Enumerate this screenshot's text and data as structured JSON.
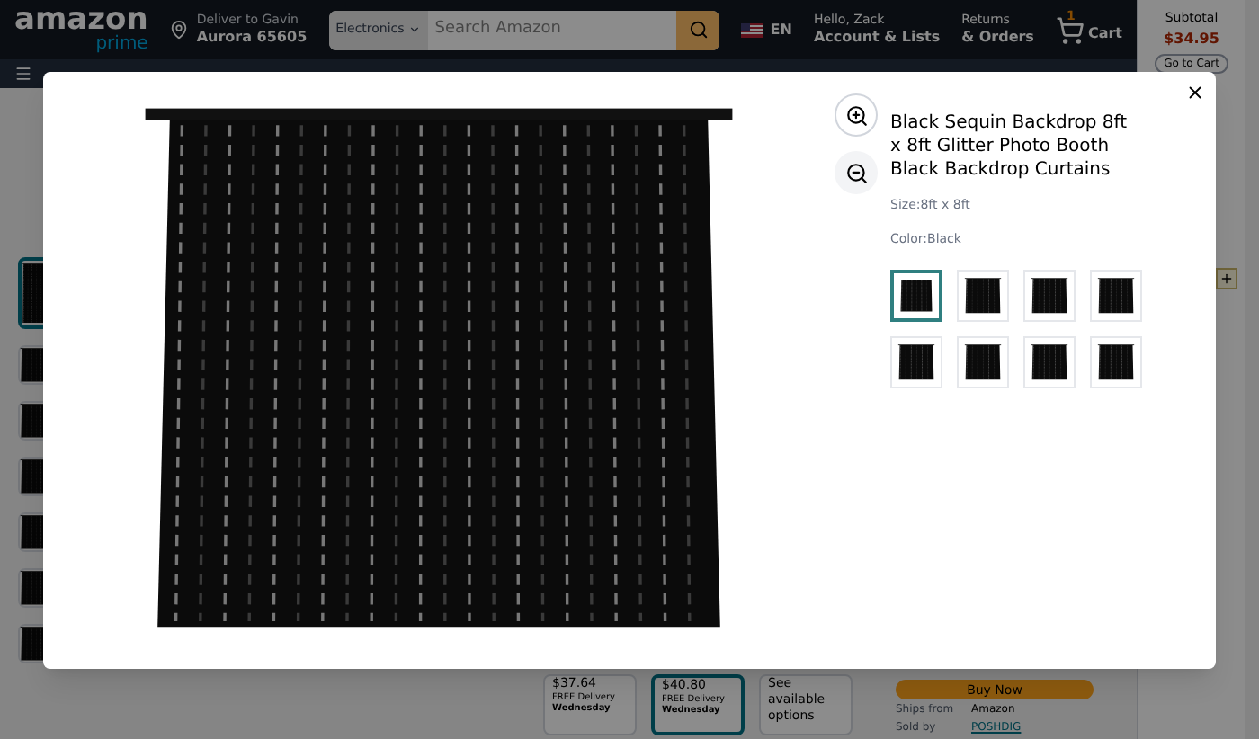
{
  "header": {
    "logo": "amazon",
    "logo_sub": "prime",
    "deliver_line1": "Deliver to Gavin",
    "deliver_line2": "Aurora 65605",
    "search_category": "Electronics",
    "search_placeholder": "Search Amazon",
    "language": "EN",
    "account_line1": "Hello, Zack",
    "account_line2": "Account & Lists",
    "orders_line1": "Returns",
    "orders_line2": "& Orders",
    "cart_count": "1",
    "cart_label": "Cart"
  },
  "subtotal": {
    "label": "Subtotal",
    "amount": "$34.95",
    "button": "Go to Cart"
  },
  "page_thumbnails": [
    {
      "selected": true
    },
    {
      "selected": false
    },
    {
      "selected": false
    },
    {
      "selected": false
    },
    {
      "selected": false
    },
    {
      "selected": false
    },
    {
      "selected": false
    }
  ],
  "size_options": [
    {
      "kind": "price",
      "price": "$37.64",
      "delivery": "FREE Delivery",
      "day": "Wednesday",
      "selected": false
    },
    {
      "kind": "price",
      "price": "$40.80",
      "delivery": "FREE Delivery",
      "day": "Wednesday",
      "selected": true
    },
    {
      "kind": "text",
      "text": "See available options",
      "selected": false
    }
  ],
  "buy_button": "Buy Now",
  "seller": [
    {
      "label": "Ships from",
      "value": "Amazon",
      "link": false
    },
    {
      "label": "Sold by",
      "value": "POSHDIG",
      "link": true
    }
  ],
  "modal": {
    "title": "Black Sequin Backdrop 8ft x 8ft Glitter Photo Booth Black Backdrop Curtains",
    "size": "Size:8ft x 8ft",
    "color_label": "Color:Black",
    "swatches": [
      {
        "selected": true
      },
      {
        "selected": false
      },
      {
        "selected": false
      },
      {
        "selected": false
      },
      {
        "selected": false
      },
      {
        "selected": false
      },
      {
        "selected": false
      },
      {
        "selected": false
      }
    ]
  }
}
